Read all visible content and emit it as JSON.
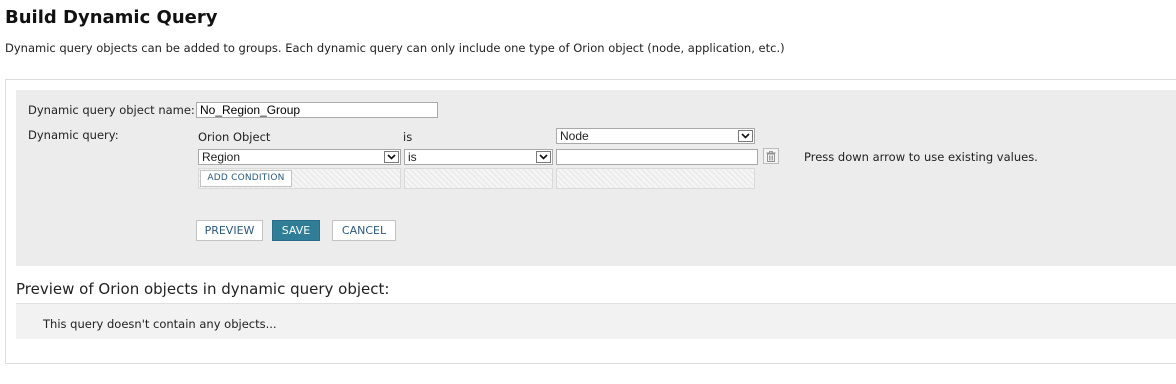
{
  "header": {
    "title": "Build Dynamic Query",
    "description": "Dynamic query objects can be added to groups. Each dynamic query can only include one type of Orion object (node, application, etc.)"
  },
  "form": {
    "name_label": "Dynamic query object name:",
    "name_value": "No_Region_Group",
    "query_label": "Dynamic query:",
    "object_col_label": "Orion Object",
    "operator_col_label": "is",
    "object_type_value": "Node",
    "condition": {
      "field_value": "Region",
      "operator_value": "is",
      "value": ""
    },
    "hint": "Press down arrow to use existing values.",
    "add_condition_label": "ADD CONDITION"
  },
  "buttons": {
    "preview": "PREVIEW",
    "save": "SAVE",
    "cancel": "CANCEL"
  },
  "preview": {
    "title": "Preview of Orion objects in dynamic query object:",
    "empty_text": "This query doesn't contain any objects..."
  },
  "colors": {
    "primary_button": "#2f7d96",
    "panel_background": "#ececec",
    "link_text": "#2c5a7a"
  },
  "icons": {
    "dropdown": "chevron-down-icon",
    "delete": "trash-icon"
  }
}
